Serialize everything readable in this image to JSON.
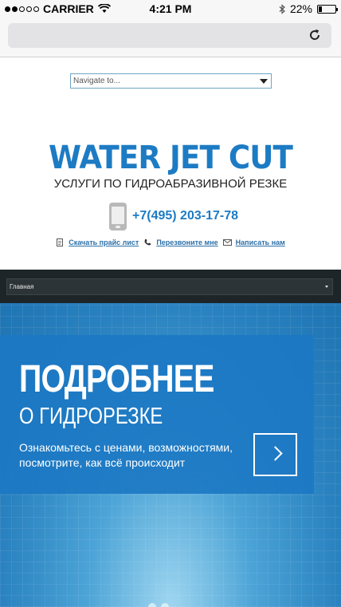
{
  "status_bar": {
    "carrier": "CARRIER",
    "time": "4:21 PM",
    "battery": "22%",
    "battery_level": 0.22,
    "icons": [
      "signal-dots-icon",
      "wifi-icon",
      "bluetooth-icon",
      "battery-icon"
    ]
  },
  "browser": {
    "reload_icon": "reload-icon"
  },
  "nav": {
    "placeholder": "Navigate to...",
    "dark_select_value": "Главная"
  },
  "header": {
    "logo": "WATER JET CUT",
    "tagline": "УСЛУГИ ПО ГИДРОАБРАЗИВНОЙ РЕЗКЕ",
    "phone": "+7(495) 203-17-78",
    "links": {
      "price": "Скачать прайс лист",
      "callback": "Перезвоните мне",
      "write": "Написать нам"
    }
  },
  "hero": {
    "title": "ПОДРОБНЕЕ",
    "subtitle": "О ГИДРОРЕЗКЕ",
    "text": "Ознакомьтесь с ценами, возможностями, посмотрите, как всё происходит"
  },
  "colors": {
    "brand_blue": "#1d7bc4",
    "dark_bar": "#1e2528",
    "link": "#2b6fa8"
  }
}
